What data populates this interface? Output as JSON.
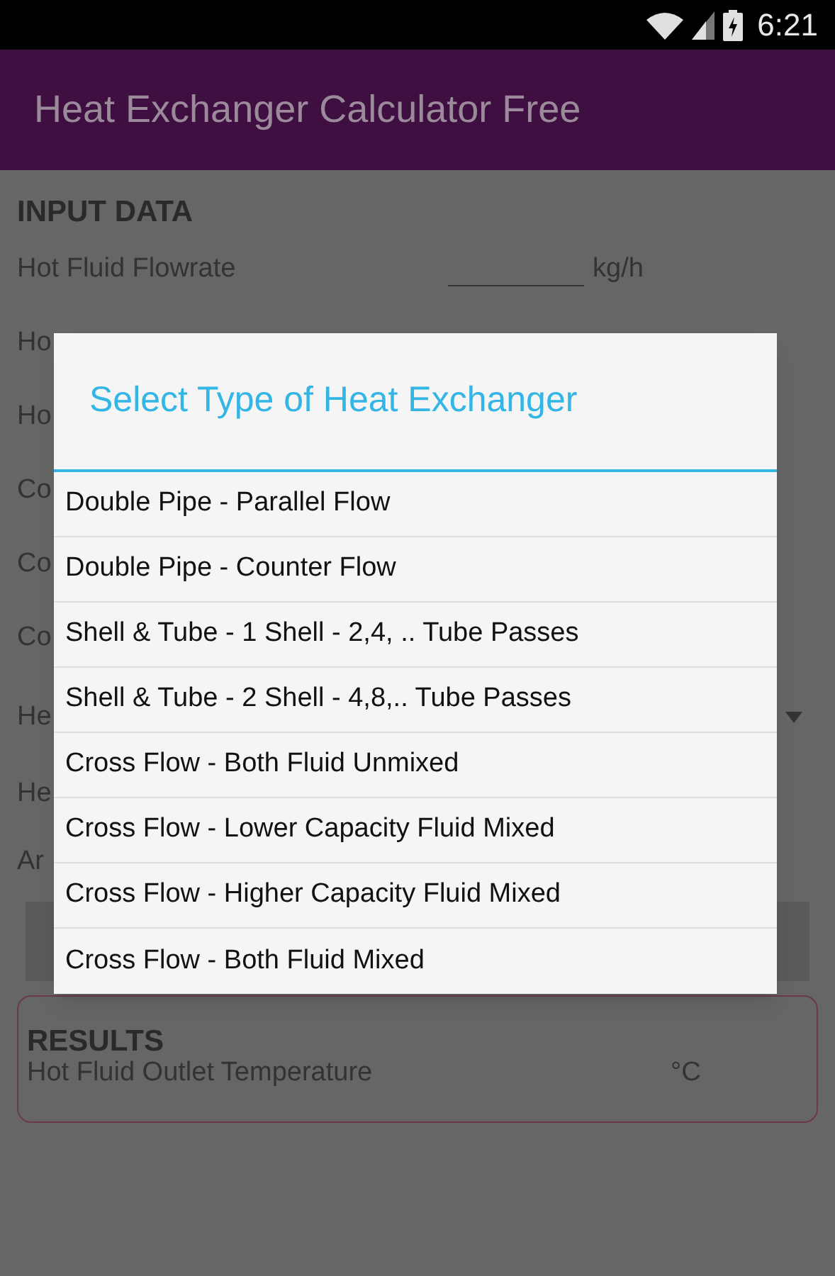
{
  "status_bar": {
    "time": "6:21"
  },
  "app_bar": {
    "title": "Heat Exchanger Calculator Free"
  },
  "input_section": {
    "heading": "INPUT DATA",
    "rows": [
      {
        "label": "Hot Fluid Flowrate",
        "unit": "kg/h",
        "kind": "field"
      },
      {
        "label": "Ho",
        "kind": "label"
      },
      {
        "label": "Ho",
        "kind": "label"
      },
      {
        "label": "Co",
        "kind": "label"
      },
      {
        "label": "Co",
        "kind": "label"
      },
      {
        "label": "Co",
        "kind": "label"
      },
      {
        "label": "He",
        "kind": "spinner"
      },
      {
        "label": "He",
        "kind": "label"
      },
      {
        "label": "Ar",
        "kind": "label"
      }
    ]
  },
  "results": {
    "heading": "RESULTS",
    "rows": [
      {
        "label": "Hot Fluid Outlet Temperature",
        "unit": "°C"
      }
    ]
  },
  "dialog": {
    "title": "Select Type of Heat Exchanger",
    "options": [
      "Double Pipe - Parallel Flow",
      "Double Pipe - Counter Flow",
      "Shell & Tube - 1 Shell - 2,4, .. Tube Passes",
      "Shell & Tube - 2 Shell - 4,8,.. Tube Passes",
      "Cross Flow - Both Fluid Unmixed",
      "Cross Flow - Lower Capacity Fluid Mixed",
      "Cross Flow - Higher Capacity Fluid Mixed",
      "Cross Flow - Both Fluid Mixed"
    ]
  }
}
